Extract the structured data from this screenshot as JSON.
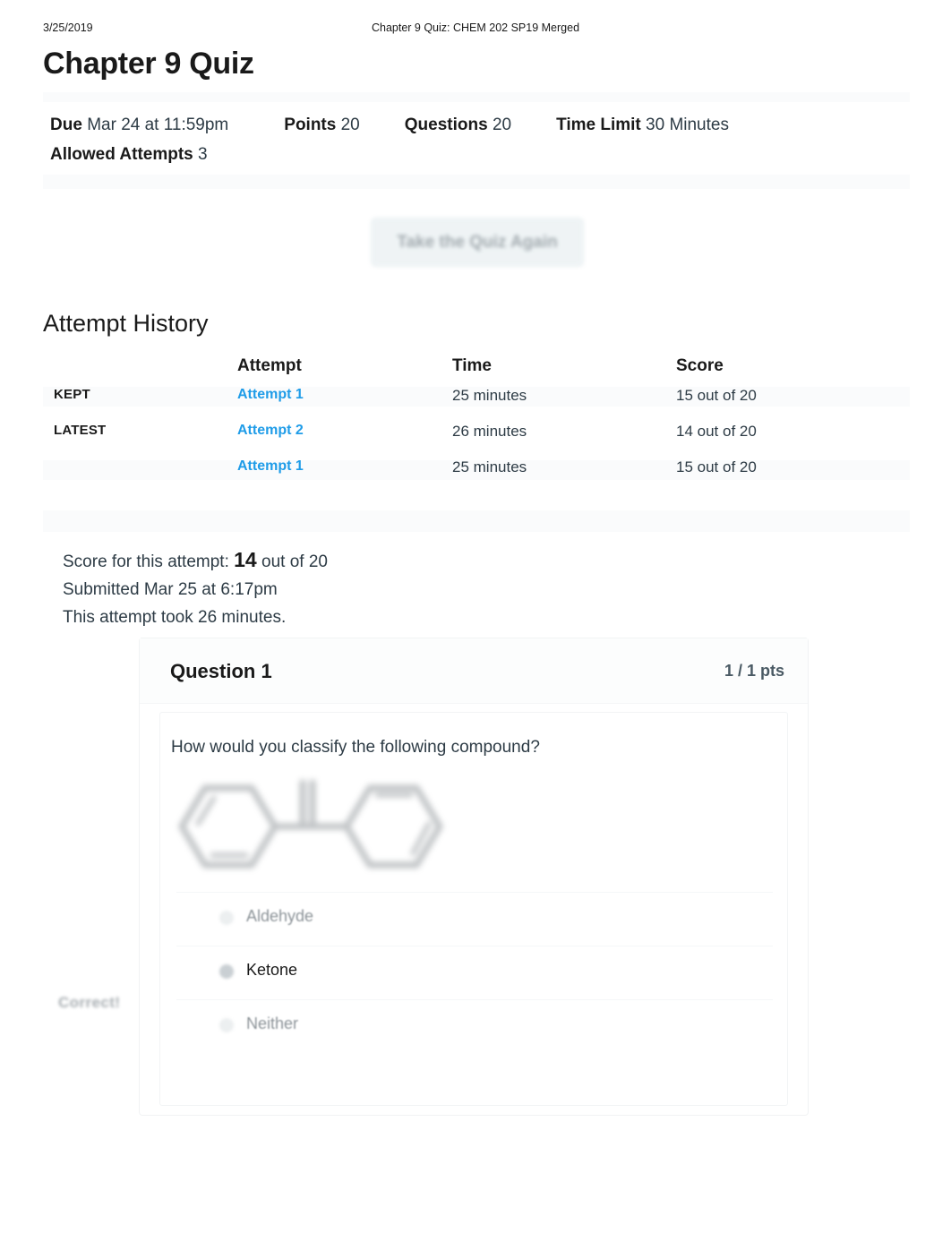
{
  "print_header": {
    "date": "3/25/2019",
    "title": "Chapter 9 Quiz: CHEM 202 SP19 Merged"
  },
  "page_title": "Chapter 9 Quiz",
  "quiz_meta": {
    "due_label": "Due",
    "due_value": "Mar 24 at 11:59pm",
    "points_label": "Points",
    "points_value": "20",
    "questions_label": "Questions",
    "questions_value": "20",
    "time_limit_label": "Time Limit",
    "time_limit_value": "30 Minutes",
    "allowed_attempts_label": "Allowed Attempts",
    "allowed_attempts_value": "3"
  },
  "retake_button": {
    "label": "Take the Quiz Again"
  },
  "attempt_history": {
    "section_title": "Attempt History",
    "columns": {
      "status": "",
      "attempt": "Attempt",
      "time": "Time",
      "score": "Score"
    },
    "rows": [
      {
        "status": "KEPT",
        "attempt": "Attempt 1",
        "time": "25 minutes",
        "score": "15 out of 20"
      },
      {
        "status": "LATEST",
        "attempt": "Attempt 2",
        "time": "26 minutes",
        "score": "14 out of 20"
      },
      {
        "status": "",
        "attempt": "Attempt 1",
        "time": "25 minutes",
        "score": "15 out of 20"
      }
    ]
  },
  "attempt_summary": {
    "score_prefix": "Score for this attempt:",
    "score_value": "14",
    "score_suffix": "out of 20",
    "submitted": "Submitted Mar 25 at 6:17pm",
    "duration": "This attempt took 26 minutes."
  },
  "question": {
    "name": "Question 1",
    "points": "1 / 1 pts",
    "prompt": "How would you classify the following compound?",
    "image_alt": "benzophenone-structure",
    "correct_flag": "Correct!",
    "options": [
      {
        "label": "Aldehyde",
        "selected": false
      },
      {
        "label": "Ketone",
        "selected": true
      },
      {
        "label": "Neither",
        "selected": false
      }
    ]
  },
  "colors": {
    "link_blue": "#1f9ce8",
    "text": "#2d3b45",
    "muted": "#8d9499",
    "band": "#fafbfc"
  }
}
